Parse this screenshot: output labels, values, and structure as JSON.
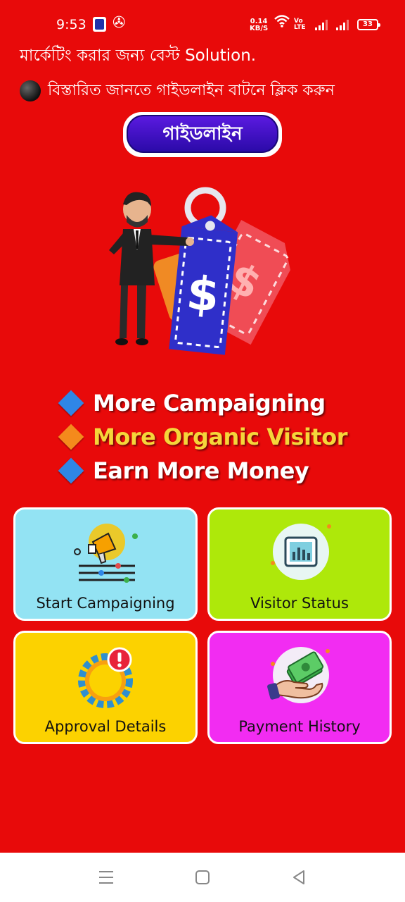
{
  "status_bar": {
    "time": "9:53",
    "net_speed_value": "0.14",
    "net_speed_unit": "KB/S",
    "volte_top": "Vo",
    "volte_bottom": "LTE",
    "battery": "33"
  },
  "header": {
    "tagline": "মার্কেটিং করার জন্য বেস্ট Solution.",
    "guide_hint": "বিস্তারিত জানতে গাইডলাইন বাটনে ক্লিক করুন"
  },
  "guide_button": {
    "label": "গাইডলাইন"
  },
  "hero": {
    "tag_symbol": "$"
  },
  "features": [
    {
      "text": "More Campaigning",
      "diamond_color": "#2f86e6",
      "text_color": "#ffffff"
    },
    {
      "text": "More Organic Visitor",
      "diamond_color": "#f48a1c",
      "text_color": "#f5d63a"
    },
    {
      "text": "Earn More Money",
      "diamond_color": "#2f86e6",
      "text_color": "#ffffff"
    }
  ],
  "cards": [
    {
      "label": "Start Campaigning",
      "bg": "#93e3f3",
      "icon": "megaphone-icon"
    },
    {
      "label": "Visitor Status",
      "bg": "#aee80a",
      "icon": "chart-icon"
    },
    {
      "label": "Approval Details",
      "bg": "#fcd200",
      "icon": "approval-gear-icon"
    },
    {
      "label": "Payment History",
      "bg": "#f22cf2",
      "icon": "cash-hand-icon"
    }
  ],
  "colors": {
    "background": "#e80a0a",
    "guide_button": "#3a10c8"
  }
}
